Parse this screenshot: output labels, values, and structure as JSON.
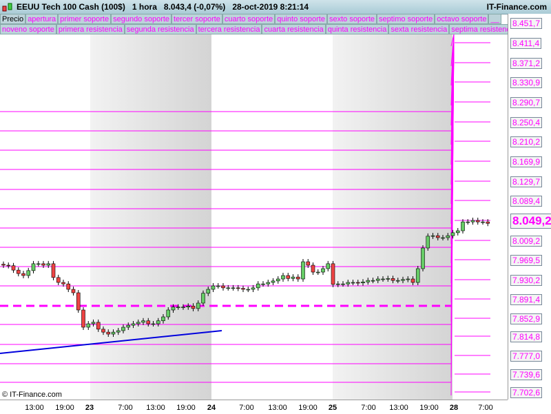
{
  "title": {
    "instrument": "EEUU Tech 100 Cash (100$)",
    "timeframe": "1 hora",
    "price": "8.043,4 (-0,07%)",
    "datetime": "28-oct-2019 8:21:14",
    "brand": "IT-Finance.com"
  },
  "legend_row1": [
    "Precio",
    "apertura",
    "primer soporte",
    "segundo soporte",
    "tercer soporte",
    "cuarto soporte",
    "quinto soporte",
    "sexto soporte",
    "septimo soporte",
    "octavo soporte",
    "__"
  ],
  "legend_row2": [
    "noveno soporte",
    "primera resistencia",
    "segunda resistencia",
    "tercera resistencia",
    "cuarta resistencia",
    "quinta resistencia",
    "sexta resistencia",
    "septima resistencia"
  ],
  "price_labels": [
    "8.451,7",
    "8.411,4",
    "8.371,2",
    "8.330,9",
    "8.290,7",
    "8.250,4",
    "8.210,2",
    "8.169,9",
    "8.129,7",
    "8.089,4",
    "8.049,2",
    "8.009,2",
    "7.969,5",
    "7.930,2",
    "7.891,4",
    "7.852,9",
    "7.814,8",
    "7.777,0",
    "7.739,6",
    "7.702,6"
  ],
  "current_price": "8.049,2",
  "x_labels": [
    "13:00",
    "19:00",
    "23",
    "7:00",
    "13:00",
    "19:00",
    "24",
    "7:00",
    "13:00",
    "19:00",
    "25",
    "7:00",
    "13:00",
    "19:00",
    "28",
    "7:00"
  ],
  "copyright": "© IT-Finance.com",
  "colors": {
    "levels": "#ff00ff",
    "trend": "#0000dd",
    "up": "#66cc66",
    "down": "#ee4444"
  },
  "chart_data": {
    "type": "candlestick",
    "closes": [
      7959,
      7958,
      7949,
      7942,
      7938,
      7948,
      7962,
      7962,
      7959,
      7962,
      7934,
      7924,
      7921,
      7910,
      7903,
      7868,
      7833,
      7840,
      7843,
      7829,
      7823,
      7819,
      7823,
      7826,
      7833,
      7837,
      7840,
      7843,
      7846,
      7840,
      7840,
      7846,
      7854,
      7868,
      7874,
      7874,
      7874,
      7876,
      7871,
      7882,
      7902,
      7910,
      7917,
      7917,
      7913,
      7913,
      7913,
      7912,
      7910,
      7910,
      7913,
      7921,
      7921,
      7924,
      7927,
      7931,
      7938,
      7932,
      7935,
      7931,
      7966,
      7959,
      7945,
      7945,
      7952,
      7962,
      7920,
      7921,
      7921,
      7924,
      7924,
      7923,
      7925,
      7928,
      7928,
      7931,
      7931,
      7932,
      7928,
      7928,
      7930,
      7931,
      7924,
      7952,
      7994,
      8018,
      8019,
      8015,
      8015,
      8019,
      8025,
      8029,
      8047,
      8047,
      8050,
      8047,
      8047,
      8044
    ]
  }
}
